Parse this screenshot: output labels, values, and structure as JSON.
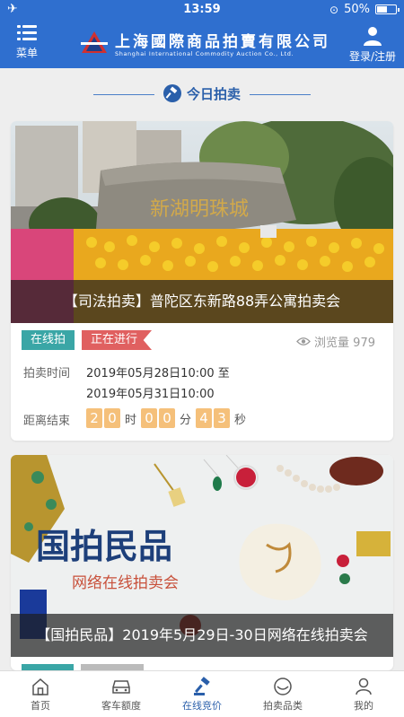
{
  "status": {
    "time": "13:59",
    "battery": "50%",
    "battery_level": 0.5
  },
  "header": {
    "menu_label": "菜单",
    "logo_cn": "上海國際商品拍賣有限公司",
    "logo_en": "Shanghai International Commodity Auction Co., Ltd.",
    "login_label": "登录/注册"
  },
  "section": {
    "title": "今日拍卖"
  },
  "auctions": [
    {
      "caption": "【司法拍卖】普陀区东新路88弄公寓拍卖会",
      "stone_text": "新湖明珠城",
      "tag_mode": "在线拍",
      "tag_status": "正在进行",
      "views_label": "浏览量 979",
      "time_label": "拍卖时间",
      "time_start": "2019年05月28日10:00 至",
      "time_end": "2019年05月31日10:00",
      "countdown_label": "距离结束",
      "cd": {
        "h1": "2",
        "h2": "0",
        "hu": "时",
        "m1": "0",
        "m2": "0",
        "mu": "分",
        "s1": "4",
        "s2": "3",
        "su": "秒"
      }
    },
    {
      "caption": "【国拍民品】2019年5月29日-30日网络在线拍卖会",
      "banner_title": "国拍民品",
      "banner_subtitle": "网络在线拍卖会"
    }
  ],
  "tabbar": [
    {
      "label": "首页",
      "icon": "home-icon"
    },
    {
      "label": "客车额度",
      "icon": "car-icon"
    },
    {
      "label": "在线竞价",
      "icon": "gavel-icon"
    },
    {
      "label": "拍卖品类",
      "icon": "bowl-icon"
    },
    {
      "label": "我的",
      "icon": "user-icon"
    }
  ],
  "colors": {
    "primary": "#2f6fcf",
    "tag_online": "#3aa6a6",
    "tag_live": "#e06060",
    "digit": "#f5c07a"
  }
}
